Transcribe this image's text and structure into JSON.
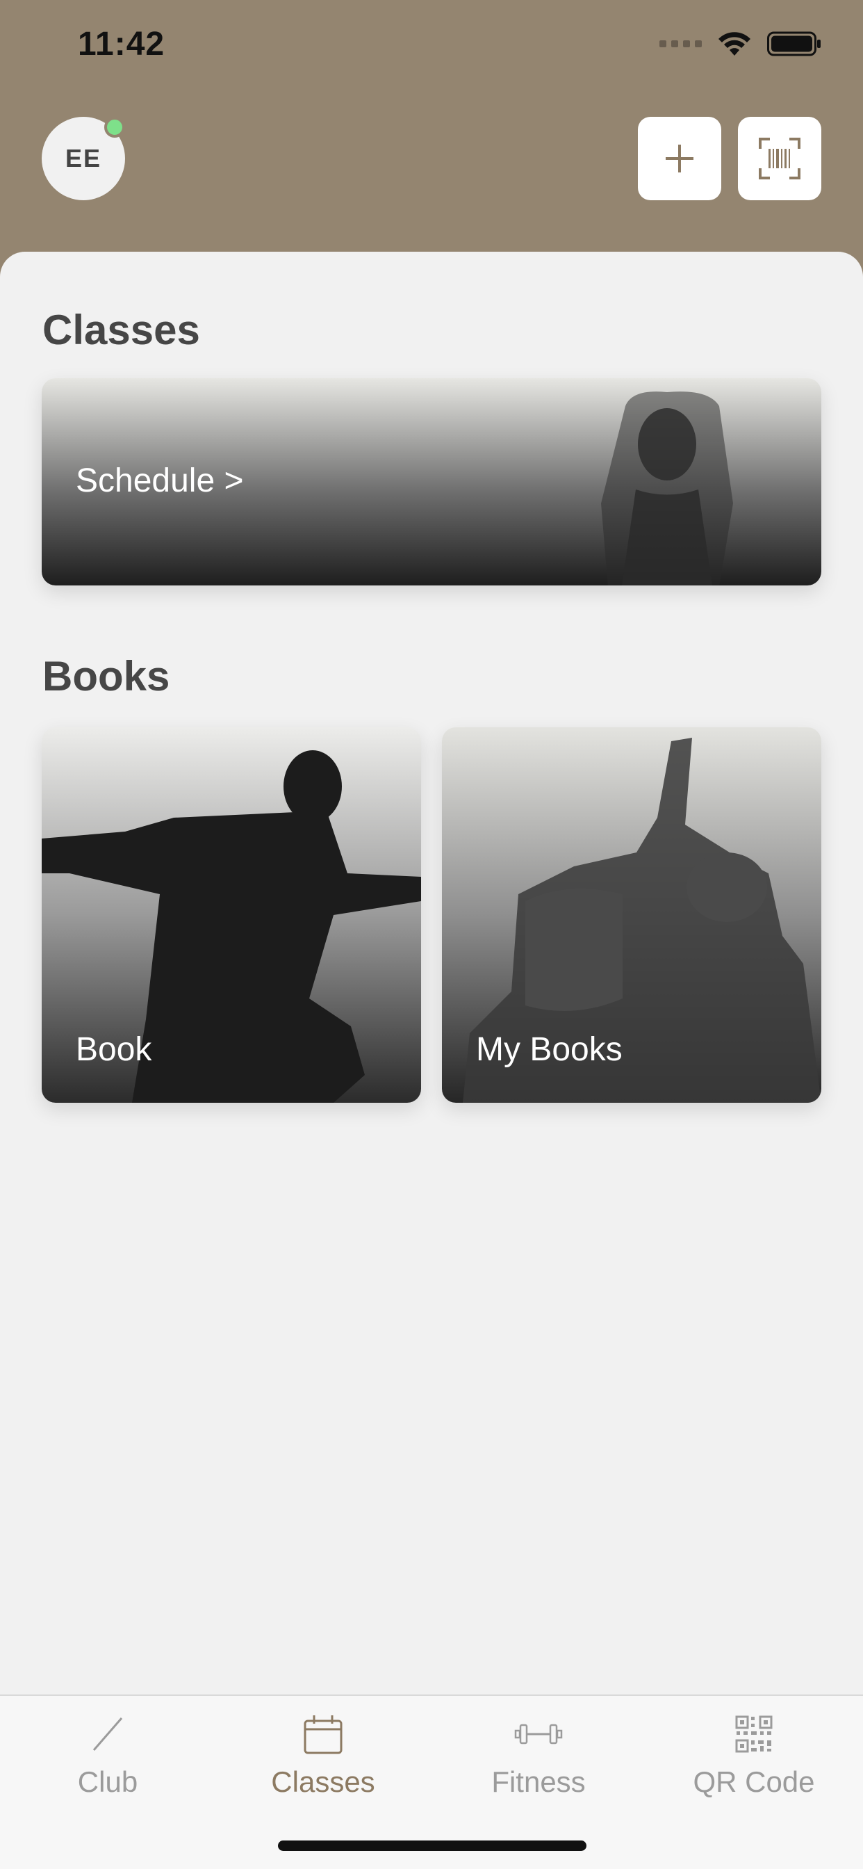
{
  "colors": {
    "header_brown": "#948570",
    "background": "#f1f1f1",
    "accent_active_tab": "#8c7a62",
    "inactive_tab": "#9b9b9b",
    "status_dot": "#7ee08a"
  },
  "status_bar": {
    "time": "11:42"
  },
  "header": {
    "avatar_initials": "EE",
    "add_button_icon": "plus-icon",
    "scan_button_icon": "barcode-scan-icon"
  },
  "classes_section": {
    "title": "Classes",
    "schedule_card": {
      "label": "Schedule >"
    }
  },
  "books_section": {
    "title": "Books",
    "cards": [
      {
        "label": "Book"
      },
      {
        "label": "My Books"
      }
    ]
  },
  "tabbar": {
    "tabs": [
      {
        "label": "Club",
        "icon": "slash-icon",
        "active": false
      },
      {
        "label": "Classes",
        "icon": "calendar-icon",
        "active": true
      },
      {
        "label": "Fitness",
        "icon": "dumbbell-icon",
        "active": false
      },
      {
        "label": "QR Code",
        "icon": "qr-code-icon",
        "active": false
      }
    ]
  }
}
